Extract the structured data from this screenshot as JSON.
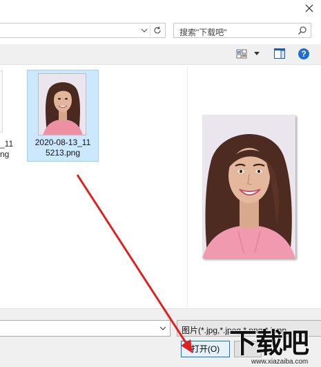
{
  "search": {
    "placeholder": "搜索\"下载吧\""
  },
  "files": {
    "left_fragment_lines": [
      "_11",
      "ng"
    ],
    "selected_item": {
      "name": "2020-08-13_11 5213.png",
      "line1": "2020-08-13_11",
      "line2": "5213.png"
    }
  },
  "bottom": {
    "filetype": "图片(*.jpg,*.jpeg,*.png,*.bmp",
    "open_label": "打开(O)"
  },
  "watermark": {
    "logo_text": "下载吧",
    "url": "www.xiazaiba.com"
  },
  "colors": {
    "selection": "#cce8ff",
    "accent": "#0078d7",
    "arrow": "#e0201c",
    "help": "#1e6fd0"
  },
  "icons": [
    "close-icon",
    "chevron-down-icon",
    "refresh-icon",
    "search-icon",
    "view-options-icon",
    "preview-pane-icon",
    "help-icon"
  ]
}
